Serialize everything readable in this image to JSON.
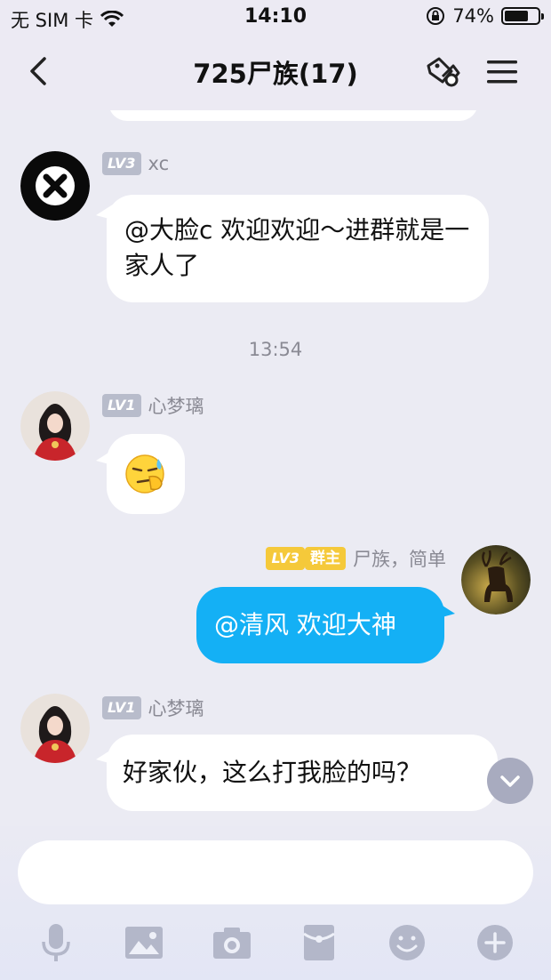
{
  "status_bar": {
    "carrier": "无 SIM 卡",
    "time": "14:10",
    "battery": "74%",
    "battery_level": 0.74
  },
  "nav": {
    "title": "725尸族(17)"
  },
  "messages": [
    {
      "sender": "xc",
      "level": "LV3",
      "text": "@大脸c 欢迎欢迎～进群就是一家人了"
    },
    {
      "timestamp": "13:54"
    },
    {
      "sender": "心梦璃",
      "level": "LV1",
      "emoji": "sweat-facepalm"
    },
    {
      "sender": "尸族，简单",
      "level": "LV3",
      "role": "群主",
      "text": "@清风 欢迎大神"
    },
    {
      "sender": "心梦璃",
      "level": "LV1",
      "text": "好家伙，这么打我脸的吗？"
    }
  ],
  "input": {
    "placeholder": ""
  },
  "toolbar": [
    "microphone-icon",
    "image-icon",
    "camera-icon",
    "red-packet-icon",
    "emoji-icon",
    "plus-icon"
  ],
  "colors": {
    "my_bubble": "#14b0f5",
    "background": "#ebebf3",
    "owner_badge": "#f5c93a",
    "level_badge": "#b8bccb"
  }
}
